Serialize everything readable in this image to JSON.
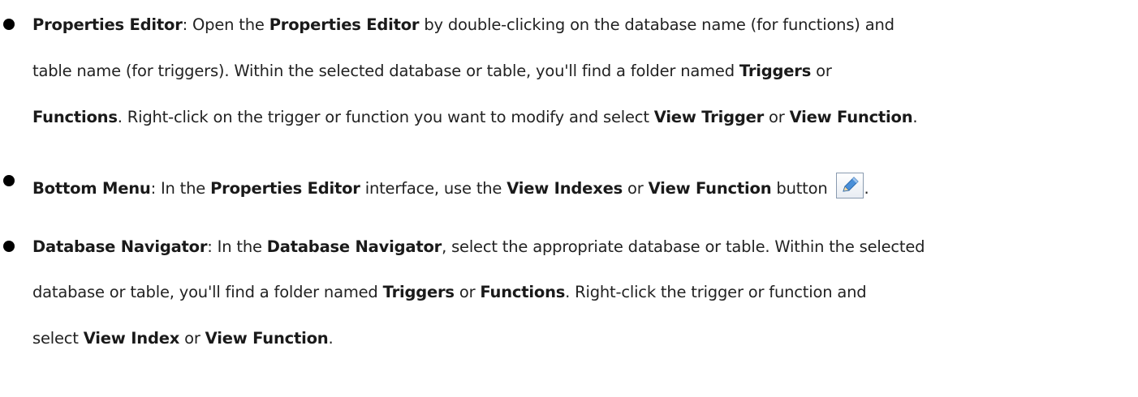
{
  "items": [
    {
      "lines": [
        [
          {
            "b": "Properties Editor"
          },
          {
            "t": ": Open the "
          },
          {
            "b": "Properties Editor"
          },
          {
            "t": " by double-clicking on the database name (for functions) and"
          }
        ],
        [
          {
            "t": "table name (for triggers). Within the selected database or table, you'll find a folder named "
          },
          {
            "b": "Triggers"
          },
          {
            "t": " or"
          }
        ],
        [
          {
            "b": "Functions"
          },
          {
            "t": ". Right-click on the trigger or function you want to modify and select "
          },
          {
            "b": "View Trigger"
          },
          {
            "t": " or "
          },
          {
            "b": "View Function"
          },
          {
            "t": "."
          }
        ]
      ]
    },
    {
      "lines": [
        [
          {
            "b": "Bottom Menu"
          },
          {
            "t": ": In the "
          },
          {
            "b": "Properties Editor"
          },
          {
            "t": " interface, use the "
          },
          {
            "b": "View Indexes"
          },
          {
            "t": " or "
          },
          {
            "b": "View Function"
          },
          {
            "t": " button "
          },
          {
            "icon": "pencil-edit-icon"
          },
          {
            "t": "."
          }
        ]
      ]
    },
    {
      "lines": [
        [
          {
            "b": "Database Navigator"
          },
          {
            "t": ": In the "
          },
          {
            "b": "Database Navigator"
          },
          {
            "t": ", select the appropriate database or table. Within the selected"
          }
        ],
        [
          {
            "t": "database or table, you'll find a folder named "
          },
          {
            "b": "Triggers"
          },
          {
            "t": " or "
          },
          {
            "b": "Functions"
          },
          {
            "t": ". Right-click the trigger or function and"
          }
        ],
        [
          {
            "t": "select "
          },
          {
            "b": "View Index"
          },
          {
            "t": " or "
          },
          {
            "b": "View Function"
          },
          {
            "t": "."
          }
        ]
      ]
    }
  ],
  "colors": {
    "text": "#222222",
    "bullet": "#000000",
    "icon_pencil": "#4a8fd8"
  }
}
